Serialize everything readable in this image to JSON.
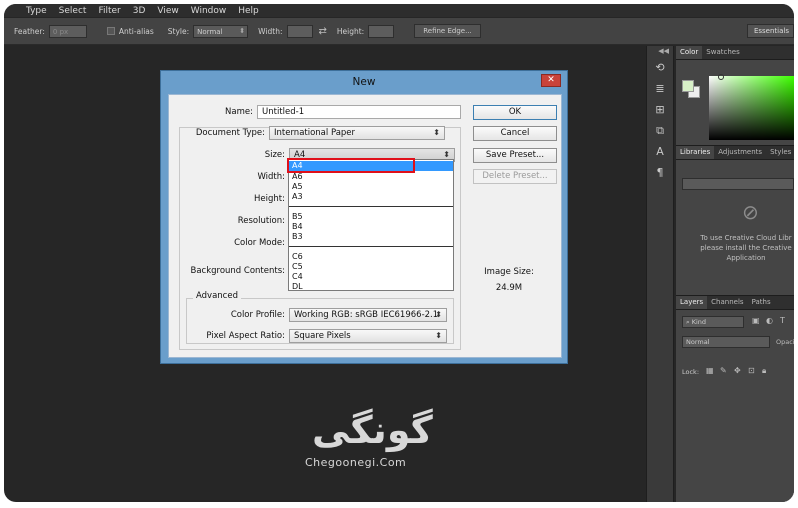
{
  "menubar": {
    "items": [
      "Type",
      "Select",
      "Filter",
      "3D",
      "View",
      "Window",
      "Help"
    ]
  },
  "options": {
    "feather_label": "Feather:",
    "feather_value": "0 px",
    "antialias_label": "Anti-alias",
    "style_label": "Style:",
    "style_value": "Normal",
    "width_label": "Width:",
    "height_label": "Height:",
    "refine_edge_label": "Refine Edge...",
    "workspace_label": "Essentials"
  },
  "panels": {
    "color_tabs": [
      "Color",
      "Swatches"
    ],
    "library_tabs": [
      "Libraries",
      "Adjustments",
      "Styles"
    ],
    "library_message": [
      "To use Creative Cloud Libr",
      "please install the Creative",
      "Application"
    ],
    "layer_tabs": [
      "Layers",
      "Channels",
      "Paths"
    ],
    "layers_kind": "Kind",
    "layers_blend": "Normal",
    "layers_opacity_label": "Opaci",
    "lock_label": "Lock:"
  },
  "dialog": {
    "title": "New",
    "close_glyph": "✕",
    "name_label": "Name:",
    "name_value": "Untitled-1",
    "doc_type_label": "Document Type:",
    "doc_type_value": "International Paper",
    "size_label": "Size:",
    "size_value": "A4",
    "width_label": "Width:",
    "height_label": "Height:",
    "resolution_label": "Resolution:",
    "color_mode_label": "Color Mode:",
    "background_label": "Background Contents:",
    "advanced_label": "Advanced",
    "color_profile_label": "Color Profile:",
    "color_profile_value": "Working RGB:  sRGB IEC61966-2.1",
    "pixel_aspect_label": "Pixel Aspect Ratio:",
    "pixel_aspect_value": "Square Pixels",
    "ok_label": "OK",
    "cancel_label": "Cancel",
    "save_preset_label": "Save Preset...",
    "delete_preset_label": "Delete Preset...",
    "image_size_label": "Image Size:",
    "image_size_value": "24.9M",
    "size_options": [
      "A4",
      "A6",
      "A5",
      "A3",
      "B5",
      "B4",
      "B3",
      "C6",
      "C5",
      "C4",
      "DL"
    ]
  },
  "watermark": {
    "text": "گونگی",
    "url": "Chegoonegi.Com"
  }
}
